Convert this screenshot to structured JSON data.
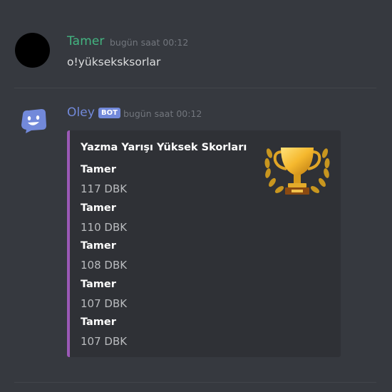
{
  "messages": [
    {
      "author": "Tamer",
      "author_color": "#43b581",
      "timestamp": "bugün saat 00:12",
      "content": "o!yükseksksorlar"
    },
    {
      "author": "Oley",
      "author_color": "#7289da",
      "bot_tag": "BOT",
      "timestamp": "bugün saat 00:12",
      "embed": {
        "color": "#9b59b6",
        "title": "Yazma Yarışı Yüksek Skorları",
        "thumbnail_icon": "trophy-icon",
        "fields": [
          {
            "name": "Tamer",
            "value": "117 DBK"
          },
          {
            "name": "Tamer",
            "value": "110 DBK"
          },
          {
            "name": "Tamer",
            "value": "108 DBK"
          },
          {
            "name": "Tamer",
            "value": "107 DBK"
          },
          {
            "name": "Tamer",
            "value": "107 DBK"
          }
        ]
      }
    }
  ]
}
